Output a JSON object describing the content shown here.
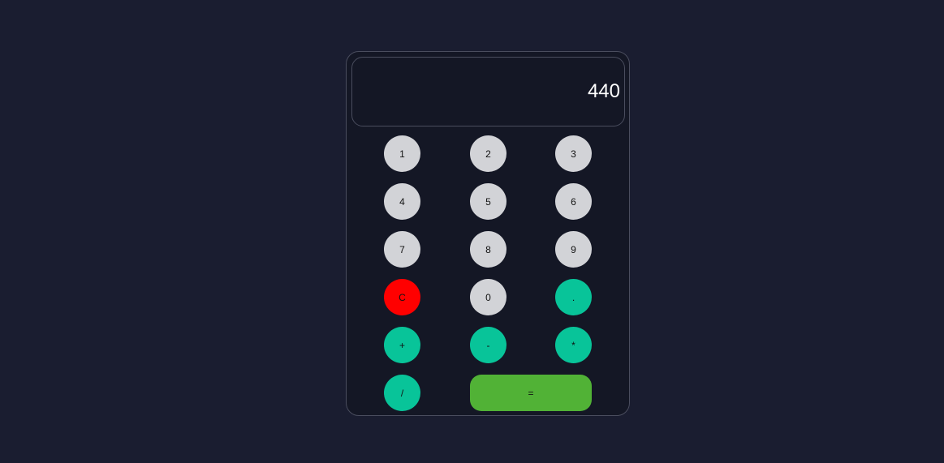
{
  "display": {
    "value": "440"
  },
  "keys": {
    "one": "1",
    "two": "2",
    "three": "3",
    "four": "4",
    "five": "5",
    "six": "6",
    "seven": "7",
    "eight": "8",
    "nine": "9",
    "clear": "C",
    "zero": "0",
    "decimal": ".",
    "plus": "+",
    "minus": "-",
    "multiply": "*",
    "divide": "/",
    "equals": "="
  },
  "colors": {
    "background": "#1a1d30",
    "panel": "#141725",
    "number_key": "#d2d3d7",
    "operator_key": "#08c499",
    "clear_key": "#ff0000",
    "equals_key": "#51b236",
    "display_text": "#ffffff"
  }
}
